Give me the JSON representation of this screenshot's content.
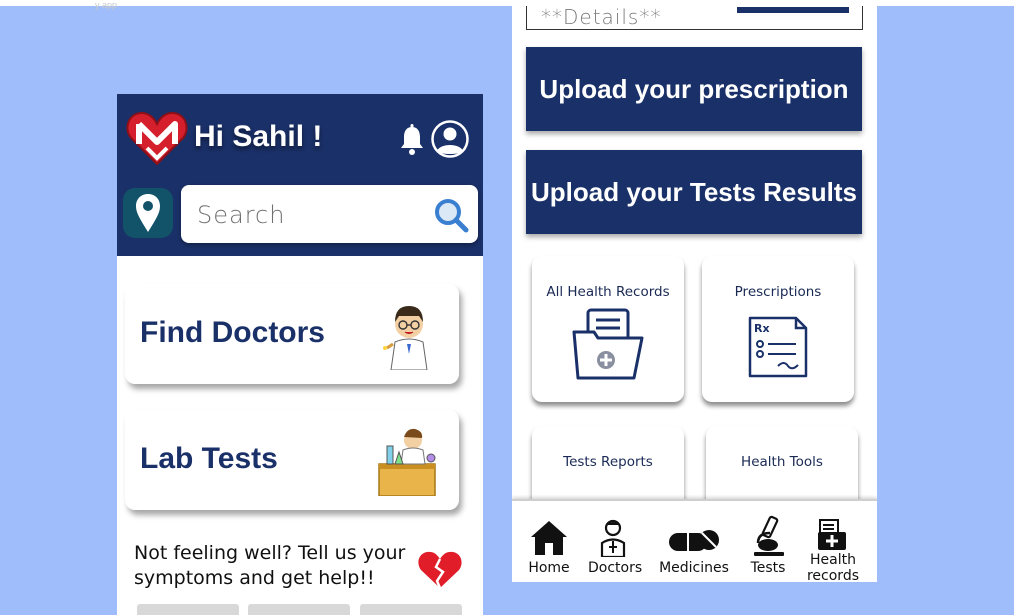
{
  "top_label": "y app",
  "left_screen": {
    "greeting": "Hi Sahil !",
    "search_placeholder": "Search",
    "cards": [
      {
        "title": "Find Doctors"
      },
      {
        "title": "Lab Tests"
      }
    ],
    "symptom_prompt": "Not feeling well? Tell us your symptoms and get help!!"
  },
  "right_screen": {
    "details_placeholder": "**Details**",
    "upload_prescription": "Upload your prescription",
    "upload_tests": "Upload your Tests Results",
    "records": [
      {
        "label": "All Health Records",
        "icon": "folder-plus-icon"
      },
      {
        "label": "Prescriptions",
        "icon": "prescription-icon"
      },
      {
        "label": "Tests Reports"
      },
      {
        "label": "Health Tools"
      }
    ],
    "nav": [
      {
        "label": "Home",
        "icon": "home-icon"
      },
      {
        "label": "Doctors",
        "icon": "doctor-icon"
      },
      {
        "label": "Medicines",
        "icon": "pill-icon"
      },
      {
        "label": "Tests",
        "icon": "microscope-icon"
      },
      {
        "label": "Health records",
        "icon": "medical-records-icon"
      }
    ]
  },
  "colors": {
    "background": "#a0bdfb",
    "primary_navy": "#1a3068",
    "location_teal": "#12536a",
    "logo_red": "#d61f2c"
  }
}
